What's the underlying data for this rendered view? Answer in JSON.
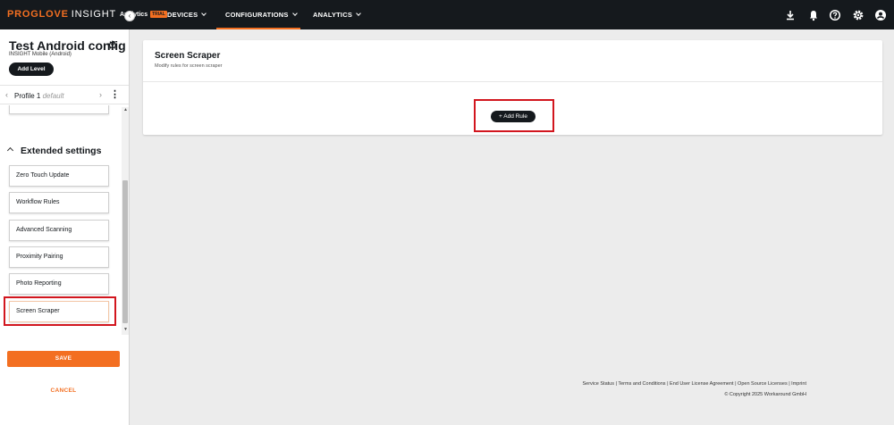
{
  "header": {
    "brand_main": "PROGLOVE",
    "brand_secondary": "INSIGHT",
    "brand_product": "Analytics",
    "brand_badge": "TRIAL",
    "nav": [
      "DEVICES",
      "CONFIGURATIONS",
      "ANALYTICS"
    ],
    "active_nav": "CONFIGURATIONS",
    "icons": [
      "download-icon",
      "bell-icon",
      "help-icon",
      "settings-icon",
      "account-icon"
    ]
  },
  "sidebar": {
    "config_title": "Test Android config",
    "config_subtitle": "INSIGHT Mobile (Android)",
    "add_level_label": "Add Level",
    "profile_name": "Profile 1",
    "profile_tag": "default",
    "section_title": "Extended settings",
    "menu_items": [
      "Zero Touch Update",
      "Workflow Rules",
      "Advanced Scanning",
      "Proximity Pairing",
      "Photo Reporting",
      "Screen Scraper"
    ],
    "selected_item": "Screen Scraper",
    "save_label": "SAVE",
    "cancel_label": "CANCEL"
  },
  "main": {
    "title": "Screen Scraper",
    "subtitle": "Modify rules for screen scraper",
    "add_rule_label": "+ Add Rule"
  },
  "footer": {
    "links_line": "Service Status | Terms and Conditions | End User License Agreement | Open Source Licenses | Imprint",
    "copyright": "© Copyright 2025 Workaround GmbH"
  },
  "colors": {
    "accent": "#f36f21",
    "topbar": "#15191d",
    "highlight": "#d2161e"
  }
}
